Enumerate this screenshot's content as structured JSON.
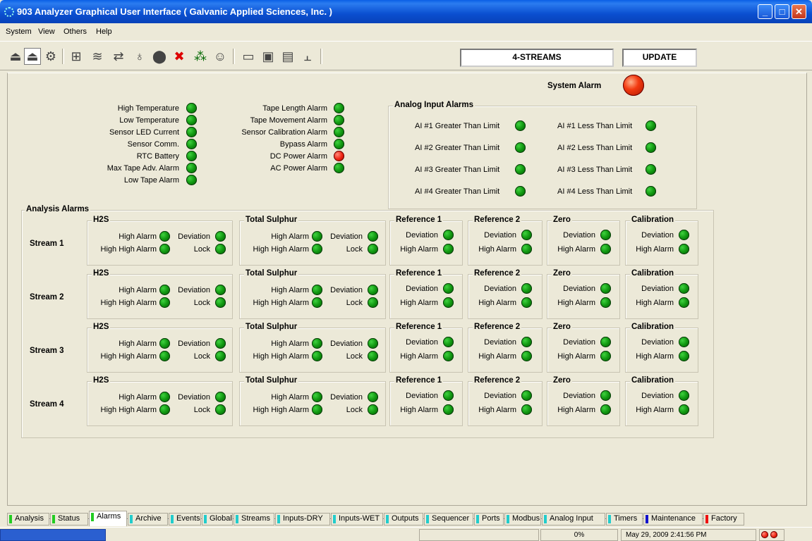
{
  "window": {
    "title": "903 Analyzer Graphical User Interface  ( Galvanic Applied Sciences, Inc. )"
  },
  "menu": [
    "System",
    "View",
    "Others",
    "Help"
  ],
  "toolbar": {
    "streams_label": "4-STREAMS",
    "update_label": "UPDATE"
  },
  "system_alarm": {
    "label": "System Alarm",
    "state": "red"
  },
  "left_alarms": [
    {
      "label": "High Temperature",
      "state": "green"
    },
    {
      "label": "Low Temperature",
      "state": "green"
    },
    {
      "label": "Sensor LED Current",
      "state": "green"
    },
    {
      "label": "Sensor Comm.",
      "state": "green"
    },
    {
      "label": "RTC Battery",
      "state": "green"
    },
    {
      "label": "Max Tape Adv. Alarm",
      "state": "green"
    },
    {
      "label": "Low Tape Alarm",
      "state": "green"
    }
  ],
  "mid_alarms": [
    {
      "label": "Tape Length Alarm",
      "state": "green"
    },
    {
      "label": "Tape Movement Alarm",
      "state": "green"
    },
    {
      "label": "Sensor Calibration Alarm",
      "state": "green"
    },
    {
      "label": "Bypass Alarm",
      "state": "green"
    },
    {
      "label": "DC Power Alarm",
      "state": "red"
    },
    {
      "label": "AC Power Alarm",
      "state": "green"
    }
  ],
  "analog": {
    "title": "Analog Input Alarms",
    "items": [
      {
        "gt": "AI #1 Greater Than Limit",
        "lt": "AI #1 Less Than Limit"
      },
      {
        "gt": "AI #2 Greater Than Limit",
        "lt": "AI #2 Less Than Limit"
      },
      {
        "gt": "AI #3 Greater Than Limit",
        "lt": "AI #3 Less Than Limit"
      },
      {
        "gt": "AI #4 Greater Than Limit",
        "lt": "AI #4 Less Than Limit"
      }
    ]
  },
  "analysis": {
    "title": "Analysis Alarms",
    "streams": [
      "Stream 1",
      "Stream 2",
      "Stream 3",
      "Stream 4"
    ],
    "groups": {
      "h2s": {
        "title": "H2S",
        "high": "High Alarm",
        "highhigh": "High High Alarm",
        "dev": "Deviation",
        "lock": "Lock"
      },
      "ts": {
        "title": "Total Sulphur",
        "high": "High Alarm",
        "highhigh": "High High Alarm",
        "dev": "Deviation",
        "lock": "Lock"
      },
      "ref1": {
        "title": "Reference 1",
        "dev": "Deviation",
        "high": "High Alarm"
      },
      "ref2": {
        "title": "Reference 2",
        "dev": "Deviation",
        "high": "High Alarm"
      },
      "zero": {
        "title": "Zero",
        "dev": "Deviation",
        "high": "High Alarm"
      },
      "cal": {
        "title": "Calibration",
        "dev": "Deviation",
        "high": "High Alarm"
      }
    }
  },
  "tabs": [
    {
      "label": "Analysis",
      "color": "#22cc22"
    },
    {
      "label": "Status",
      "color": "#22cc22"
    },
    {
      "label": "Alarms",
      "color": "#22cc22",
      "active": true
    },
    {
      "label": "Archive",
      "color": "#22cccc"
    },
    {
      "label": "Events",
      "color": "#22cccc"
    },
    {
      "label": "Global",
      "color": "#22cccc"
    },
    {
      "label": "Streams",
      "color": "#22cccc"
    },
    {
      "label": "Inputs-DRY",
      "color": "#22cccc"
    },
    {
      "label": "Inputs-WET",
      "color": "#22cccc"
    },
    {
      "label": "Outputs",
      "color": "#22cccc"
    },
    {
      "label": "Sequencer",
      "color": "#22cccc"
    },
    {
      "label": "Ports",
      "color": "#22cccc"
    },
    {
      "label": "Modbus",
      "color": "#22cccc"
    },
    {
      "label": "Analog Input",
      "color": "#22cccc"
    },
    {
      "label": "Timers",
      "color": "#22cccc"
    },
    {
      "label": "Maintenance",
      "color": "#1111cc"
    },
    {
      "label": "Factory",
      "color": "#ee1111"
    }
  ],
  "status": {
    "percent": "0%",
    "datetime": "May 29, 2009 2:41:56 PM"
  }
}
